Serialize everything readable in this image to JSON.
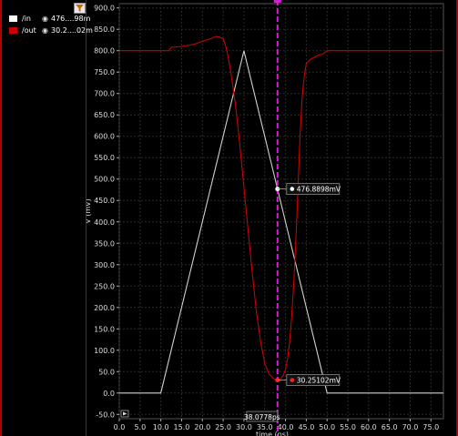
{
  "legend": {
    "items": [
      {
        "name": "/in",
        "color": "#ffffff",
        "value": "476....98m",
        "icon": "eye-icon"
      },
      {
        "name": "/out",
        "color": "#cc0000",
        "value": "30.2....02m",
        "icon": "eye-icon"
      }
    ],
    "filter_icon": "filter-icon"
  },
  "chart_data": {
    "type": "line",
    "xlabel": "time (ps)",
    "ylabel": "V (mV)",
    "xlim": [
      0,
      78
    ],
    "ylim": [
      -60,
      910
    ],
    "xticks": [
      "0.0",
      "5.0",
      "10.0",
      "15.0",
      "20.0",
      "25.0",
      "30.0",
      "35.0",
      "40.0",
      "45.0",
      "50.0",
      "55.0",
      "60.0",
      "65.0",
      "70.0",
      "75.0"
    ],
    "yticks": [
      "-50.0",
      "0.0",
      "50.0",
      "100.0",
      "150.0",
      "200.0",
      "250.0",
      "300.0",
      "350.0",
      "400.0",
      "450.0",
      "500.0",
      "550.0",
      "600.0",
      "650.0",
      "700.0",
      "750.0",
      "800.0",
      "850.0",
      "900.0"
    ],
    "series": [
      {
        "name": "/in",
        "color": "#d0d0d0",
        "x": [
          0,
          10,
          30,
          50,
          78
        ],
        "y": [
          0,
          0,
          800,
          0,
          0
        ]
      },
      {
        "name": "/out",
        "color": "#cc0000",
        "x": [
          0,
          12,
          12.5,
          15,
          18,
          20,
          21,
          22,
          22.5,
          23,
          23.5,
          24,
          24.5,
          25,
          25.5,
          26,
          26.5,
          27,
          28,
          29,
          30,
          31,
          32,
          33,
          34,
          35,
          36,
          37,
          37.5,
          38,
          38.5,
          39,
          39.5,
          40,
          40.5,
          41,
          41.5,
          42,
          42.5,
          43,
          43.5,
          44,
          44.5,
          45,
          46,
          47,
          48,
          49,
          50,
          78
        ],
        "y": [
          800,
          800,
          808,
          810,
          815,
          822,
          825,
          828,
          830,
          833,
          833,
          832,
          830,
          828,
          815,
          795,
          770,
          740,
          670,
          580,
          480,
          380,
          280,
          190,
          120,
          70,
          45,
          35,
          32,
          31,
          32,
          35,
          42,
          55,
          80,
          120,
          180,
          260,
          360,
          480,
          600,
          690,
          740,
          770,
          780,
          785,
          790,
          792,
          800,
          800
        ]
      }
    ],
    "cursor": {
      "x": 38.0778,
      "label": "38.0778ps",
      "color": "#d81bd8"
    },
    "markers": [
      {
        "series": "/in",
        "x": 38.0778,
        "y": 476.8898,
        "label": "476.8898mV",
        "color": "#ffffff"
      },
      {
        "series": "/out",
        "x": 38.0778,
        "y": 30.25102,
        "label": "30.25102mV",
        "color": "#ff2020"
      }
    ],
    "grid": true
  }
}
